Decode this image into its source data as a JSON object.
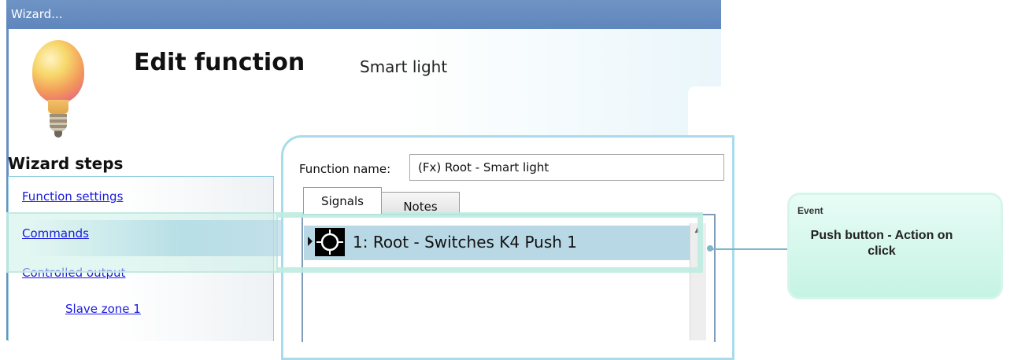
{
  "window": {
    "title": "Wizard..."
  },
  "header": {
    "title": "Edit function",
    "subtitle": "Smart light",
    "icon": "light-bulb-icon"
  },
  "sidebar": {
    "title": "Wizard steps",
    "steps": [
      {
        "label": "Function settings"
      },
      {
        "label": "Commands"
      },
      {
        "label": "Controlled output"
      },
      {
        "label": "Slave zone 1"
      }
    ]
  },
  "main": {
    "function_name_label": "Function name:",
    "function_name_value": "(Fx) Root - Smart light",
    "tabs": [
      {
        "label": "Signals",
        "selected": true
      },
      {
        "label": "Notes",
        "selected": false
      }
    ],
    "signals": [
      {
        "label": "1: Root - Switches K4 Push 1",
        "icon": "push-button-icon"
      }
    ]
  },
  "callout": {
    "title": "Event",
    "text": "Push button - Action on click"
  },
  "colors": {
    "titlebar": "#5f86bd",
    "link": "#1a1ae0",
    "row_highlight": "#b8d8e6",
    "callout_bg": "#c5f3e4",
    "overlay": "#ccf0e8"
  }
}
